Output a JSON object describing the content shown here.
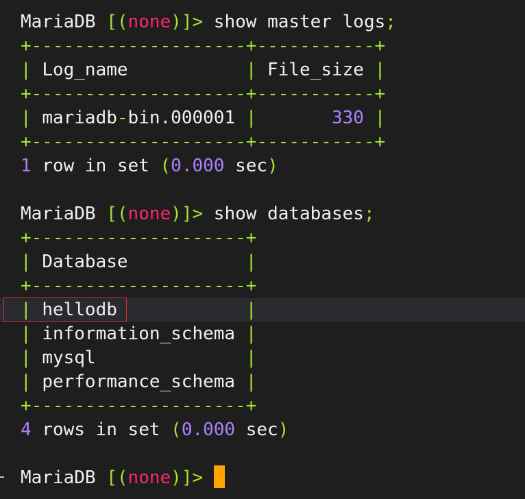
{
  "prompt": {
    "client": "MariaDB",
    "open": "[",
    "paren_open": "(",
    "db": "none",
    "paren_close": ")",
    "close": "]>"
  },
  "cmd1": {
    "text": "show master logs",
    "semicolon": ";"
  },
  "table1": {
    "border": "+--------------------+-----------+",
    "header": {
      "col1": "Log_name          ",
      "col2": "File_size"
    },
    "rows": [
      {
        "name": "mariadb-bin.000001",
        "size": "330"
      }
    ]
  },
  "result1": {
    "count": "1",
    "text": " row in set ",
    "time": "0.000",
    "unit": " sec"
  },
  "cmd2": {
    "text": "show databases",
    "semicolon": ";"
  },
  "table2": {
    "border": "+--------------------+",
    "header": "Database          ",
    "rows": [
      "hellodb           ",
      "information_schema",
      "mysql             ",
      "performance_schema"
    ]
  },
  "result2": {
    "count": "4",
    "text": " rows in set ",
    "time": "0.000",
    "unit": " sec"
  },
  "colors": {
    "background": "#1e1e1e",
    "border": "#a6e22e",
    "keyword_none": "#f92672",
    "number": "#ae81ff",
    "cursor": "#ffa500"
  }
}
